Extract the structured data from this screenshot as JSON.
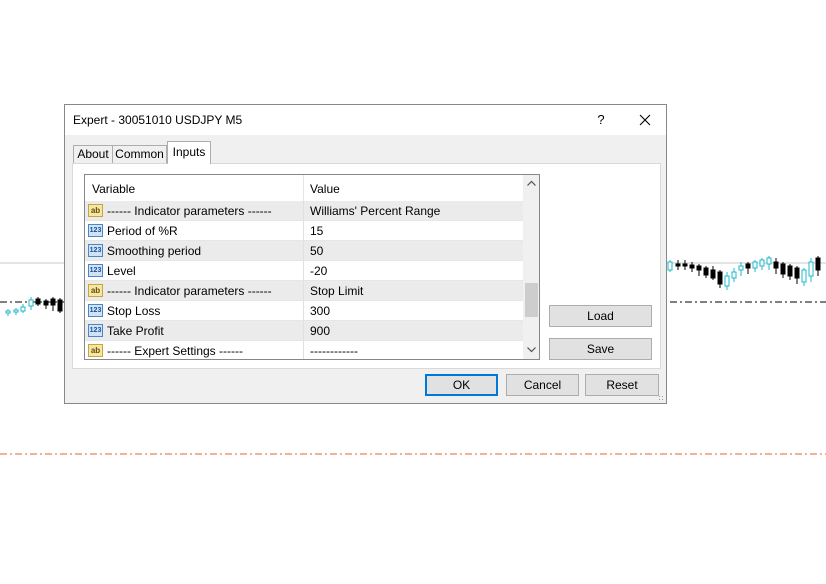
{
  "window": {
    "title": "Expert - 30051010 USDJPY M5",
    "help_label": "?",
    "close_label": "✕"
  },
  "tabs": [
    {
      "label": "About",
      "active": false
    },
    {
      "label": "Common",
      "active": false
    },
    {
      "label": "Inputs",
      "active": true
    }
  ],
  "grid": {
    "columns": {
      "variable": "Variable",
      "value": "Value"
    },
    "rows": [
      {
        "icon": "text-icon",
        "icon_text": "ab",
        "variable": "------ Indicator parameters ------",
        "value": "Williams' Percent Range"
      },
      {
        "icon": "number-icon",
        "icon_text": "123",
        "variable": "Period of %R",
        "value": "15"
      },
      {
        "icon": "number-icon",
        "icon_text": "123",
        "variable": "Smoothing period",
        "value": "50"
      },
      {
        "icon": "number-icon",
        "icon_text": "123",
        "variable": "Level",
        "value": "-20"
      },
      {
        "icon": "text-icon",
        "icon_text": "ab",
        "variable": "------ Indicator parameters ------",
        "value": "Stop Limit"
      },
      {
        "icon": "number-icon",
        "icon_text": "123",
        "variable": "Stop Loss",
        "value": "300"
      },
      {
        "icon": "number-icon",
        "icon_text": "123",
        "variable": "Take Profit",
        "value": "900"
      },
      {
        "icon": "text-icon",
        "icon_text": "ab",
        "variable": "------ Expert Settings ------",
        "value": "------------"
      }
    ],
    "scroll_up": "^",
    "scroll_down": "v"
  },
  "side_buttons": {
    "load": "Load",
    "save": "Save"
  },
  "footer_buttons": {
    "ok": "OK",
    "cancel": "Cancel",
    "reset": "Reset"
  },
  "colors": {
    "bull_candle": "#1fb8c8",
    "bear_candle": "#000000",
    "stop_line": "#e8652a",
    "focus_border": "#0078d7"
  }
}
